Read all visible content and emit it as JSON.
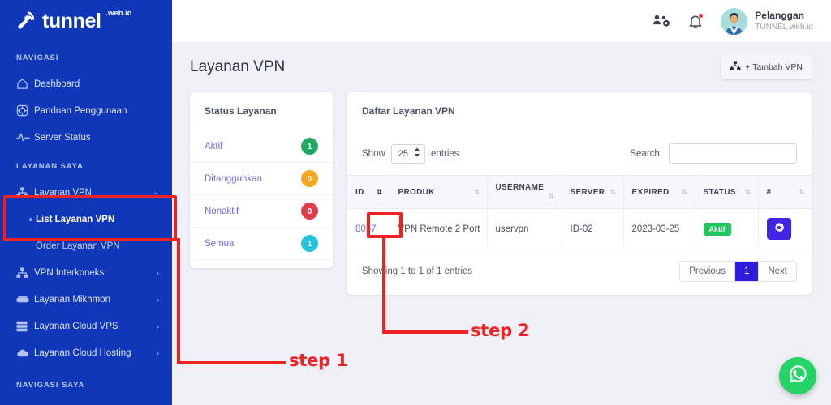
{
  "brand": {
    "name": "tunnel",
    "suffix": ".web.id",
    "logo_icon": "satellite-dish-icon"
  },
  "sidebar": {
    "sections": [
      {
        "title": "NAVIGASI"
      },
      {
        "title": "LAYANAN SAYA"
      },
      {
        "title": "NAVIGASI SAYA"
      }
    ],
    "items": [
      {
        "label": "Dashboard",
        "icon": "home-icon"
      },
      {
        "label": "Panduan Penggunaan",
        "icon": "lifebuoy-icon"
      },
      {
        "label": "Server Status",
        "icon": "activity-pulse-icon"
      },
      {
        "label": "Layanan VPN",
        "icon": "network-tree-icon",
        "chevron": "⌄"
      },
      {
        "label": "List Layanan VPN"
      },
      {
        "label": "Order Layanan VPN"
      },
      {
        "label": "VPN Interkoneksi",
        "icon": "network-tree-icon",
        "chevron": "›"
      },
      {
        "label": "Layanan Mikhmon",
        "icon": "server-icon",
        "chevron": "›"
      },
      {
        "label": "Layanan Cloud VPS",
        "icon": "stack-icon",
        "chevron": "›"
      },
      {
        "label": "Layanan Cloud Hosting",
        "icon": "cloud-icon",
        "chevron": "›"
      }
    ]
  },
  "topbar": {
    "users_icon": "users-gear-icon",
    "bell_icon": "bell-icon",
    "avatar_icon": "user-avatar",
    "user_name": "Pelanggan",
    "user_sub": "TUNNEL.web.id"
  },
  "page": {
    "title": "Layanan VPN",
    "add_button": "+ Tambah VPN",
    "add_button_icon": "network-tree-icon"
  },
  "status_card": {
    "title": "Status Layanan",
    "rows": [
      {
        "label": "Aktif",
        "count": "1",
        "color": "#1eab64"
      },
      {
        "label": "Ditangguhkan",
        "count": "0",
        "color": "#f5a623"
      },
      {
        "label": "Nonaktif",
        "count": "0",
        "color": "#e03c4a"
      },
      {
        "label": "Semua",
        "count": "1",
        "color": "#24c3dd"
      }
    ]
  },
  "table_card": {
    "title": "Daftar Layanan VPN",
    "show_label": "Show",
    "entries_label": "entries",
    "page_size": "25",
    "search_label": "Search:",
    "search_value": "",
    "search_placeholder": "",
    "columns": [
      {
        "label": "ID",
        "sorted": true
      },
      {
        "label": "PRODUK",
        "sorted": false
      },
      {
        "label": "USERNAME",
        "sorted": false
      },
      {
        "label": "SERVER",
        "sorted": false
      },
      {
        "label": "EXPIRED",
        "sorted": false
      },
      {
        "label": "STATUS",
        "sorted": false
      },
      {
        "label": "#",
        "sorted": false
      }
    ],
    "rows": [
      {
        "id": "8057",
        "produk": "VPN Remote 2 Port",
        "username": "uservpn",
        "server": "ID-02",
        "expired": "2023-03-25",
        "status": "Aktif",
        "action_icon": "gear-icon"
      }
    ],
    "showing": "Showing 1 to 1 of 1 entries",
    "pager": {
      "previous": "Previous",
      "page": "1",
      "next": "Next"
    }
  },
  "annotations": [
    {
      "label": "step 1"
    },
    {
      "label": "step 2"
    }
  ],
  "floating": {
    "whatsapp_icon": "whatsapp-icon"
  },
  "colors": {
    "sidebar_bg": "#1037b8",
    "accent": "#2f1ae0",
    "annotation": "#ee2222",
    "whatsapp": "#25d366",
    "status_active": "#22c55e"
  }
}
